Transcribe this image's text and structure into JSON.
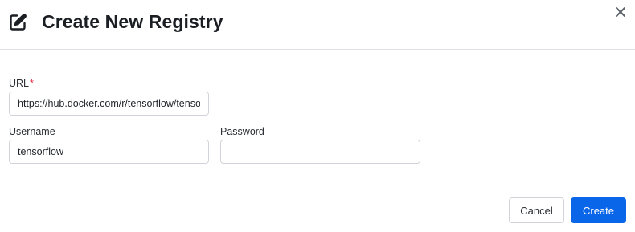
{
  "dialog": {
    "title": "Create New Registry",
    "header_icon": "edit-icon",
    "close_icon": "close-icon"
  },
  "form": {
    "url": {
      "label": "URL",
      "required_marker": "*",
      "value": "https://hub.docker.com/r/tensorflow/tensorflow"
    },
    "username": {
      "label": "Username",
      "value": "tensorflow"
    },
    "password": {
      "label": "Password",
      "value": ""
    }
  },
  "actions": {
    "cancel_label": "Cancel",
    "create_label": "Create"
  },
  "colors": {
    "primary": "#0a66e8",
    "required": "#e0243a"
  }
}
